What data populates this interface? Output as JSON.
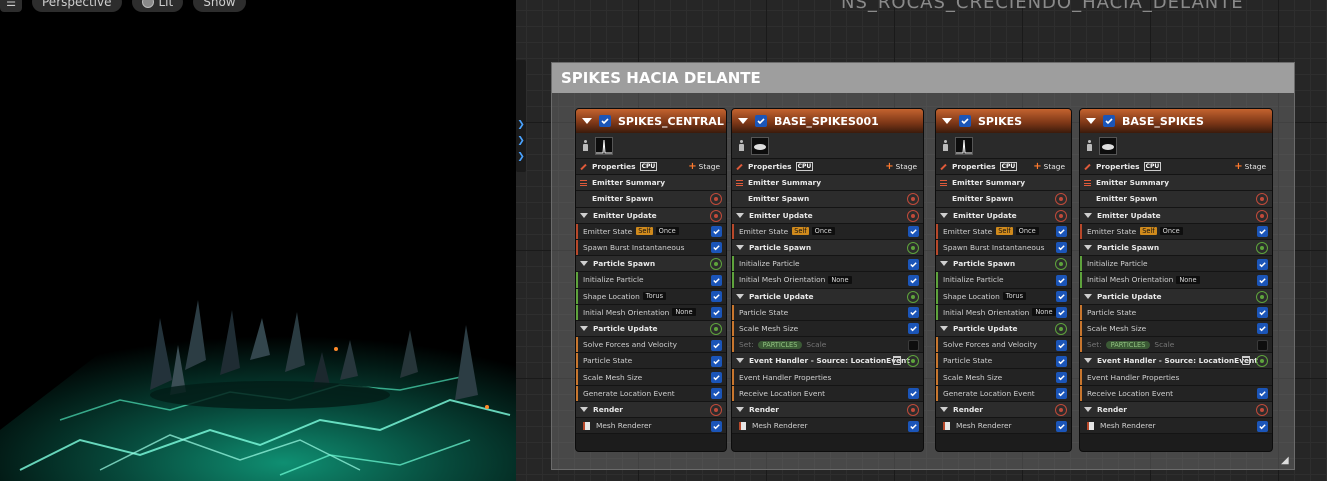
{
  "viewport": {
    "menu_icon": "hamburger-icon",
    "perspective_label": "Perspective",
    "lit_label": "Lit",
    "show_label": "Show"
  },
  "graph": {
    "asset_title": "NS_ROCAS_CRECIENDO_HACIA_DELANTE",
    "comment_title": "SPIKES HACIA DELANTE"
  },
  "colors": {
    "emitter_header": "#c4632f",
    "spawn_bar": "#c8762e",
    "update_bar": "#5ea33c",
    "render_bar": "#b8482a",
    "checkbox": "#1b55b8",
    "particles_pill": "#3b5a35"
  },
  "emitters": [
    {
      "name": "SPIKES_CENTRAL",
      "properties_label": "Properties",
      "cpu_label": "CPU",
      "stage_label": "Stage",
      "summary_label": "Emitter Summary",
      "emitter_spawn_label": "Emitter Spawn",
      "emitter_update_label": "Emitter Update",
      "emitter_state_label": "Emitter State",
      "self_tag": "Self",
      "once_tag": "Once",
      "spawn_burst_label": "Spawn Burst Instantaneous",
      "particle_spawn_label": "Particle Spawn",
      "initialize_particle_label": "Initialize Particle",
      "shape_location_label": "Shape Location",
      "torus_tag": "Torus",
      "initial_mesh_orientation_label": "Initial Mesh Orientation",
      "none_tag": "None",
      "particle_update_label": "Particle Update",
      "solve_forces_label": "Solve Forces and Velocity",
      "particle_state_label": "Particle State",
      "scale_mesh_size_label": "Scale Mesh Size",
      "generate_location_event_label": "Generate Location Event",
      "render_label": "Render",
      "mesh_renderer_label": "Mesh Renderer"
    },
    {
      "name": "BASE_SPIKES001",
      "properties_label": "Properties",
      "cpu_label": "CPU",
      "stage_label": "Stage",
      "summary_label": "Emitter Summary",
      "emitter_spawn_label": "Emitter Spawn",
      "emitter_update_label": "Emitter Update",
      "emitter_state_label": "Emitter State",
      "self_tag": "Self",
      "once_tag": "Once",
      "particle_spawn_label": "Particle Spawn",
      "initialize_particle_label": "Initialize Particle",
      "initial_mesh_orientation_label": "Initial Mesh Orientation",
      "none_tag": "None",
      "particle_update_label": "Particle Update",
      "particle_state_label": "Particle State",
      "scale_mesh_size_label": "Scale Mesh Size",
      "set_label": "Set:",
      "particles_tag": "PARTICLES",
      "scale_label": "Scale",
      "event_handler_label": "Event Handler - Source: LocationEvent",
      "event_handler_properties_label": "Event Handler Properties",
      "receive_location_event_label": "Receive Location Event",
      "render_label": "Render",
      "mesh_renderer_label": "Mesh Renderer"
    },
    {
      "name": "SPIKES",
      "properties_label": "Properties",
      "cpu_label": "CPU",
      "stage_label": "Stage",
      "summary_label": "Emitter Summary",
      "emitter_spawn_label": "Emitter Spawn",
      "emitter_update_label": "Emitter Update",
      "emitter_state_label": "Emitter State",
      "self_tag": "Self",
      "once_tag": "Once",
      "spawn_burst_label": "Spawn Burst Instantaneous",
      "particle_spawn_label": "Particle Spawn",
      "initialize_particle_label": "Initialize Particle",
      "shape_location_label": "Shape Location",
      "torus_tag": "Torus",
      "initial_mesh_orientation_label": "Initial Mesh Orientation",
      "none_tag": "None",
      "particle_update_label": "Particle Update",
      "solve_forces_label": "Solve Forces and Velocity",
      "particle_state_label": "Particle State",
      "scale_mesh_size_label": "Scale Mesh Size",
      "generate_location_event_label": "Generate Location Event",
      "render_label": "Render",
      "mesh_renderer_label": "Mesh Renderer"
    },
    {
      "name": "BASE_SPIKES",
      "properties_label": "Properties",
      "cpu_label": "CPU",
      "stage_label": "Stage",
      "summary_label": "Emitter Summary",
      "emitter_spawn_label": "Emitter Spawn",
      "emitter_update_label": "Emitter Update",
      "emitter_state_label": "Emitter State",
      "self_tag": "Self",
      "once_tag": "Once",
      "particle_spawn_label": "Particle Spawn",
      "initialize_particle_label": "Initialize Particle",
      "initial_mesh_orientation_label": "Initial Mesh Orientation",
      "none_tag": "None",
      "particle_update_label": "Particle Update",
      "particle_state_label": "Particle State",
      "scale_mesh_size_label": "Scale Mesh Size",
      "set_label": "Set:",
      "particles_tag": "PARTICLES",
      "scale_label": "Scale",
      "event_handler_label": "Event Handler - Source: LocationEvent",
      "event_handler_properties_label": "Event Handler Properties",
      "receive_location_event_label": "Receive Location Event",
      "render_label": "Render",
      "mesh_renderer_label": "Mesh Renderer"
    }
  ]
}
